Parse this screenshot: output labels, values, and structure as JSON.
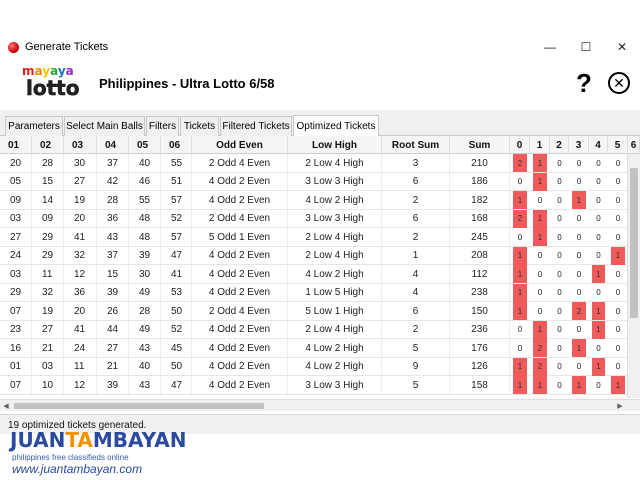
{
  "window": {
    "title": "Generate Tickets",
    "minimize": "—",
    "maximize": "☐",
    "close": "✕"
  },
  "header": {
    "logo_top": "mayaya",
    "logo_bottom": "lotto",
    "title": "Philippines - Ultra Lotto 6/58",
    "help": "?",
    "close": "✕"
  },
  "tabs": [
    "Parameters",
    "Select Main Balls",
    "Filters",
    "Tickets",
    "Filtered Tickets",
    "Optimized Tickets"
  ],
  "active_tab": "Optimized Tickets",
  "columns": [
    "01",
    "02",
    "03",
    "04",
    "05",
    "06",
    "Odd Even",
    "Low High",
    "Root Sum",
    "Sum",
    "0",
    "1",
    "2",
    "3",
    "4",
    "5",
    "6"
  ],
  "rows": [
    {
      "n": [
        "20",
        "28",
        "30",
        "37",
        "40",
        "55"
      ],
      "oe": "2 Odd 4 Even",
      "lh": "2 Low 4 High",
      "rs": "3",
      "sum": "210",
      "d": [
        "2",
        "1",
        "0",
        "0",
        "0",
        "0"
      ]
    },
    {
      "n": [
        "05",
        "15",
        "27",
        "42",
        "46",
        "51"
      ],
      "oe": "4 Odd 2 Even",
      "lh": "3 Low 3 High",
      "rs": "6",
      "sum": "186",
      "d": [
        "0",
        "1",
        "0",
        "0",
        "0",
        "0"
      ]
    },
    {
      "n": [
        "09",
        "14",
        "19",
        "28",
        "55",
        "57"
      ],
      "oe": "4 Odd 2 Even",
      "lh": "4 Low 2 High",
      "rs": "2",
      "sum": "182",
      "d": [
        "1",
        "0",
        "0",
        "1",
        "0",
        "0"
      ]
    },
    {
      "n": [
        "03",
        "09",
        "20",
        "36",
        "48",
        "52"
      ],
      "oe": "2 Odd 4 Even",
      "lh": "3 Low 3 High",
      "rs": "6",
      "sum": "168",
      "d": [
        "2",
        "1",
        "0",
        "0",
        "0",
        "0"
      ]
    },
    {
      "n": [
        "27",
        "29",
        "41",
        "43",
        "48",
        "57"
      ],
      "oe": "5 Odd 1 Even",
      "lh": "2 Low 4 High",
      "rs": "2",
      "sum": "245",
      "d": [
        "0",
        "1",
        "0",
        "0",
        "0",
        "0"
      ]
    },
    {
      "n": [
        "24",
        "29",
        "32",
        "37",
        "39",
        "47"
      ],
      "oe": "4 Odd 2 Even",
      "lh": "2 Low 4 High",
      "rs": "1",
      "sum": "208",
      "d": [
        "1",
        "0",
        "0",
        "0",
        "0",
        "1"
      ]
    },
    {
      "n": [
        "03",
        "11",
        "12",
        "15",
        "30",
        "41"
      ],
      "oe": "4 Odd 2 Even",
      "lh": "4 Low 2 High",
      "rs": "4",
      "sum": "112",
      "d": [
        "1",
        "0",
        "0",
        "0",
        "1",
        "0"
      ]
    },
    {
      "n": [
        "29",
        "32",
        "36",
        "39",
        "49",
        "53"
      ],
      "oe": "4 Odd 2 Even",
      "lh": "1 Low 5 High",
      "rs": "4",
      "sum": "238",
      "d": [
        "1",
        "0",
        "0",
        "0",
        "0",
        "0"
      ]
    },
    {
      "n": [
        "07",
        "19",
        "20",
        "26",
        "28",
        "50"
      ],
      "oe": "2 Odd 4 Even",
      "lh": "5 Low 1 High",
      "rs": "6",
      "sum": "150",
      "d": [
        "1",
        "0",
        "0",
        "2",
        "1",
        "0"
      ]
    },
    {
      "n": [
        "23",
        "27",
        "41",
        "44",
        "49",
        "52"
      ],
      "oe": "4 Odd 2 Even",
      "lh": "2 Low 4 High",
      "rs": "2",
      "sum": "236",
      "d": [
        "0",
        "1",
        "0",
        "0",
        "1",
        "0"
      ]
    },
    {
      "n": [
        "16",
        "21",
        "24",
        "27",
        "43",
        "45"
      ],
      "oe": "4 Odd 2 Even",
      "lh": "4 Low 2 High",
      "rs": "5",
      "sum": "176",
      "d": [
        "0",
        "2",
        "0",
        "1",
        "0",
        "0"
      ]
    },
    {
      "n": [
        "01",
        "03",
        "11",
        "21",
        "40",
        "50"
      ],
      "oe": "4 Odd 2 Even",
      "lh": "4 Low 2 High",
      "rs": "9",
      "sum": "126",
      "d": [
        "1",
        "2",
        "0",
        "0",
        "1",
        "0"
      ]
    },
    {
      "n": [
        "07",
        "10",
        "12",
        "39",
        "43",
        "47"
      ],
      "oe": "4 Odd 2 Even",
      "lh": "3 Low 3 High",
      "rs": "5",
      "sum": "158",
      "d": [
        "1",
        "1",
        "0",
        "1",
        "0",
        "1"
      ]
    }
  ],
  "hot_color": "#ef5a5a",
  "status": "19 optimized tickets generated.",
  "watermark": {
    "brand": "JUANTAMBAYAN",
    "tagline": "philippines free classifieds online",
    "url": "www.juantambayan.com"
  }
}
